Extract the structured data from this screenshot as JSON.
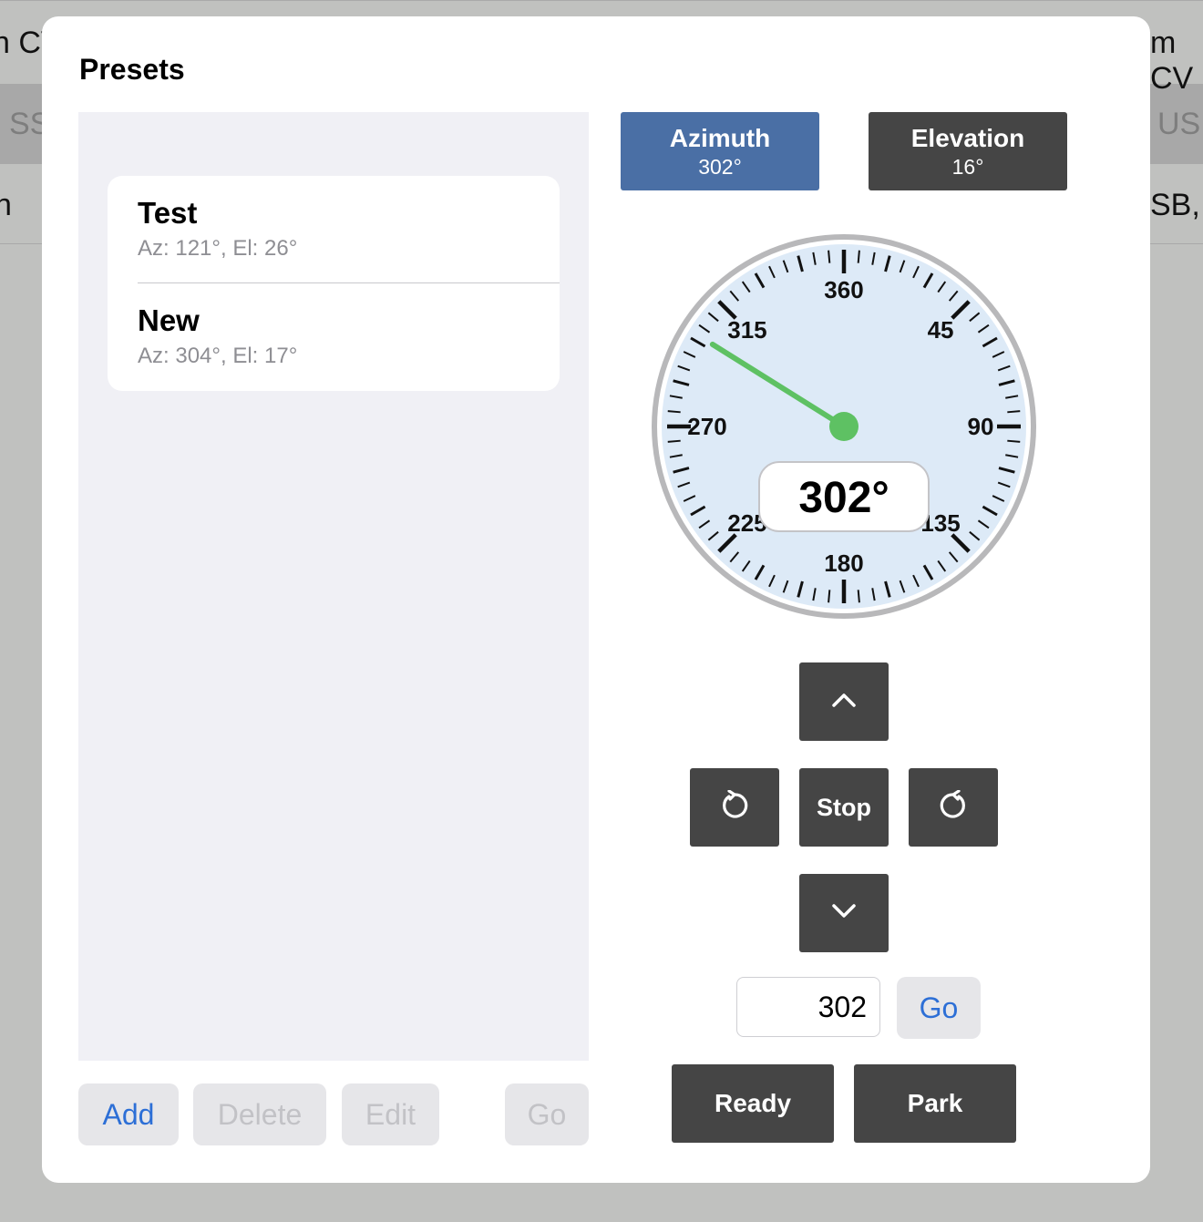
{
  "background": {
    "left_texts": [
      "n CV",
      "SS",
      "n"
    ],
    "right_texts": [
      "m CV",
      "USE",
      "SB,"
    ]
  },
  "dialog": {
    "title": "Presets",
    "presets": [
      {
        "name": "Test",
        "detail": "Az: 121°, El: 26°"
      },
      {
        "name": "New",
        "detail": "Az: 304°, El: 17°"
      }
    ],
    "buttons": {
      "add": "Add",
      "delete": "Delete",
      "edit": "Edit",
      "go": "Go"
    }
  },
  "rotator": {
    "azimuth_label": "Azimuth",
    "azimuth_value": "302°",
    "elevation_label": "Elevation",
    "elevation_value": "16°",
    "selected_axis": "azimuth",
    "gauge": {
      "heading_deg": 302,
      "readout": "302°",
      "major_labels": [
        "360",
        "45",
        "90",
        "135",
        "180",
        "225",
        "270",
        "315"
      ],
      "needle_color": "#5ec163",
      "face_color": "#ddeaf7"
    },
    "stop_label": "Stop",
    "goto_value": "302",
    "go_label": "Go",
    "ready_label": "Ready",
    "park_label": "Park"
  },
  "colors": {
    "accent": "#2d6fd6",
    "selected_button": "#4a6fa5",
    "dark_button": "#454545"
  }
}
